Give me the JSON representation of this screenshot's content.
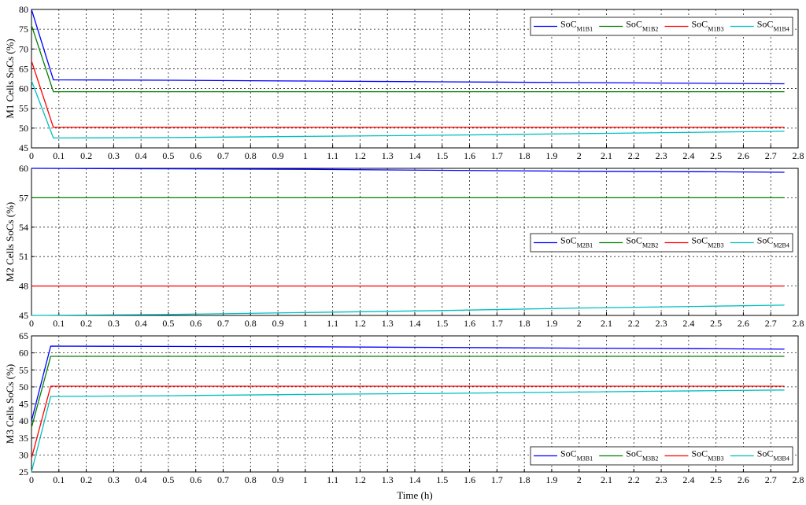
{
  "colors": {
    "B1": "#0000ff",
    "B2": "#008000",
    "B3": "#ff0000",
    "B4": "#00bfbf"
  },
  "chart_data": [
    {
      "type": "line",
      "ylabel": "M1 Cells SoCs (%)",
      "xlabel": "",
      "xlim": [
        0,
        2.8
      ],
      "ylim": [
        45,
        80
      ],
      "xticks": [
        "0",
        "0.1",
        "0.2",
        "0.3",
        "0.4",
        "0.5",
        "0.6",
        "0.7",
        "0.8",
        "0.9",
        "1",
        "1.1",
        "1.2",
        "1.3",
        "1.4",
        "1.5",
        "1.6",
        "1.7",
        "1.8",
        "1.9",
        "2",
        "2.1",
        "2.2",
        "2.3",
        "2.4",
        "2.5",
        "2.6",
        "2.7",
        "2.8"
      ],
      "yticks": [
        "45",
        "50",
        "55",
        "60",
        "65",
        "70",
        "75",
        "80"
      ],
      "legend_position": "top-right",
      "series": [
        {
          "name": "SoC",
          "sub": "M1B1",
          "color_key": "B1",
          "x": [
            0,
            0.08,
            0.5,
            1.0,
            1.5,
            2.0,
            2.5,
            2.75
          ],
          "y": [
            80,
            62.2,
            62.1,
            61.9,
            61.7,
            61.5,
            61.3,
            61.2
          ]
        },
        {
          "name": "SoC",
          "sub": "M1B2",
          "color_key": "B2",
          "x": [
            0,
            0.08,
            2.75
          ],
          "y": [
            76,
            59.2,
            59.2
          ]
        },
        {
          "name": "SoC",
          "sub": "M1B3",
          "color_key": "B3",
          "x": [
            0,
            0.08,
            2.75
          ],
          "y": [
            67,
            50.2,
            50.2
          ]
        },
        {
          "name": "SoC",
          "sub": "M1B4",
          "color_key": "B4",
          "x": [
            0,
            0.08,
            0.5,
            1.0,
            1.5,
            2.0,
            2.5,
            2.75
          ],
          "y": [
            62,
            47.5,
            47.6,
            47.9,
            48.2,
            48.6,
            49.0,
            49.2
          ]
        }
      ]
    },
    {
      "type": "line",
      "ylabel": "M2 Cells SoCs (%)",
      "xlabel": "",
      "xlim": [
        0,
        2.8
      ],
      "ylim": [
        45,
        60
      ],
      "xticks": [
        "0",
        "0.1",
        "0.2",
        "0.3",
        "0.4",
        "0.5",
        "0.6",
        "0.7",
        "0.8",
        "0.9",
        "1",
        "1.1",
        "1.2",
        "1.3",
        "1.4",
        "1.5",
        "1.6",
        "1.7",
        "1.8",
        "1.9",
        "2",
        "2.1",
        "2.2",
        "2.3",
        "2.4",
        "2.5",
        "2.6",
        "2.7",
        "2.8"
      ],
      "yticks": [
        "45",
        "48",
        "51",
        "54",
        "57",
        "60"
      ],
      "legend_position": "middle-right",
      "series": [
        {
          "name": "SoC",
          "sub": "M2B1",
          "color_key": "B1",
          "x": [
            0,
            0.5,
            1.0,
            1.5,
            2.0,
            2.5,
            2.75
          ],
          "y": [
            60,
            59.95,
            59.9,
            59.8,
            59.7,
            59.65,
            59.6
          ]
        },
        {
          "name": "SoC",
          "sub": "M2B2",
          "color_key": "B2",
          "x": [
            0,
            2.75
          ],
          "y": [
            57,
            57
          ]
        },
        {
          "name": "SoC",
          "sub": "M2B3",
          "color_key": "B3",
          "x": [
            0,
            2.75
          ],
          "y": [
            48,
            48
          ]
        },
        {
          "name": "SoC",
          "sub": "M2B4",
          "color_key": "B4",
          "x": [
            0,
            0.5,
            1.0,
            1.5,
            2.0,
            2.5,
            2.75
          ],
          "y": [
            45,
            45.1,
            45.3,
            45.5,
            45.75,
            45.95,
            46.05
          ]
        }
      ]
    },
    {
      "type": "line",
      "ylabel": "M3 Cells SoCs (%)",
      "xlabel": "Time (h)",
      "xlim": [
        0,
        2.8
      ],
      "ylim": [
        25,
        65
      ],
      "xticks": [
        "0",
        "0.1",
        "0.2",
        "0.3",
        "0.4",
        "0.5",
        "0.6",
        "0.7",
        "0.8",
        "0.9",
        "1",
        "1.1",
        "1.2",
        "1.3",
        "1.4",
        "1.5",
        "1.6",
        "1.7",
        "1.8",
        "1.9",
        "2",
        "2.1",
        "2.2",
        "2.3",
        "2.4",
        "2.5",
        "2.6",
        "2.7",
        "2.8"
      ],
      "yticks": [
        "25",
        "30",
        "35",
        "40",
        "45",
        "50",
        "55",
        "60",
        "65"
      ],
      "legend_position": "bottom-right",
      "series": [
        {
          "name": "SoC",
          "sub": "M3B1",
          "color_key": "B1",
          "x": [
            0,
            0.07,
            0.5,
            1.0,
            1.5,
            2.0,
            2.5,
            2.75
          ],
          "y": [
            40,
            62,
            61.9,
            61.8,
            61.6,
            61.4,
            61.2,
            61.1
          ]
        },
        {
          "name": "SoC",
          "sub": "M3B2",
          "color_key": "B2",
          "x": [
            0,
            0.07,
            2.75
          ],
          "y": [
            38,
            59,
            59
          ]
        },
        {
          "name": "SoC",
          "sub": "M3B3",
          "color_key": "B3",
          "x": [
            0,
            0.07,
            2.75
          ],
          "y": [
            29,
            50.2,
            50.2
          ]
        },
        {
          "name": "SoC",
          "sub": "M3B4",
          "color_key": "B4",
          "x": [
            0,
            0.07,
            0.5,
            1.0,
            1.5,
            2.0,
            2.5,
            2.75
          ],
          "y": [
            25,
            47.2,
            47.4,
            47.8,
            48.1,
            48.5,
            48.9,
            49.1
          ]
        }
      ]
    }
  ]
}
